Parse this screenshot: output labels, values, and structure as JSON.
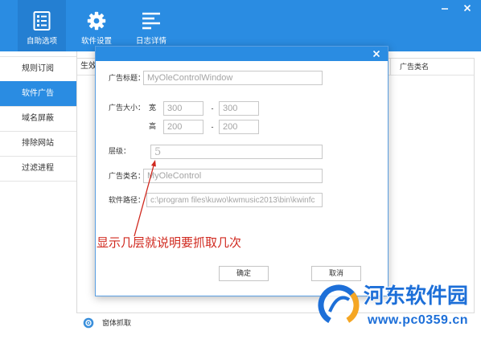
{
  "colors": {
    "primary": "#2a8ce2",
    "annotation": "#d0281e",
    "watermark": "#1d6fd8",
    "watermark_accent": "#f5a623"
  },
  "window_controls": {
    "minimize_icon": "minimize-icon",
    "close_icon": "close-icon"
  },
  "toolbar": {
    "active_index": 0,
    "items": [
      {
        "label": "自助选项",
        "icon": "checklist-icon"
      },
      {
        "label": "软件设置",
        "icon": "gear-icon"
      },
      {
        "label": "日志详情",
        "icon": "log-lines-icon"
      }
    ]
  },
  "sidebar": {
    "selected_index": 1,
    "items": [
      {
        "label": "规则订阅"
      },
      {
        "label": "软件广告"
      },
      {
        "label": "域名屏蔽"
      },
      {
        "label": "排除网站"
      },
      {
        "label": "过滤进程"
      }
    ]
  },
  "table": {
    "columns": [
      "生效",
      "广告类名"
    ]
  },
  "dialog": {
    "close_icon": "close-icon",
    "fields": {
      "ad_title": {
        "label": "广告标题：",
        "value": "MyOleControlWindow"
      },
      "ad_size": {
        "label": "广告大小：",
        "width_label": "宽",
        "height_label": "高",
        "separator": "-",
        "width_from": "300",
        "width_to": "300",
        "height_from": "200",
        "height_to": "200"
      },
      "level": {
        "label": "层级：",
        "value": "5"
      },
      "ad_class": {
        "label": "广告类名：",
        "value": "MyOleControl"
      },
      "software_path": {
        "label": "软件路径：",
        "value": "c:\\program files\\kuwo\\kwmusic2013\\bin\\kwinfc"
      }
    },
    "annotation": "显示几层就说明要抓取几次",
    "ok_label": "确定",
    "cancel_label": "取消"
  },
  "footer": {
    "capture": {
      "label": "窗体抓取",
      "icon": "capture-icon"
    }
  },
  "watermark": {
    "name": "河东软件园",
    "url": "www.pc0359.cn"
  }
}
